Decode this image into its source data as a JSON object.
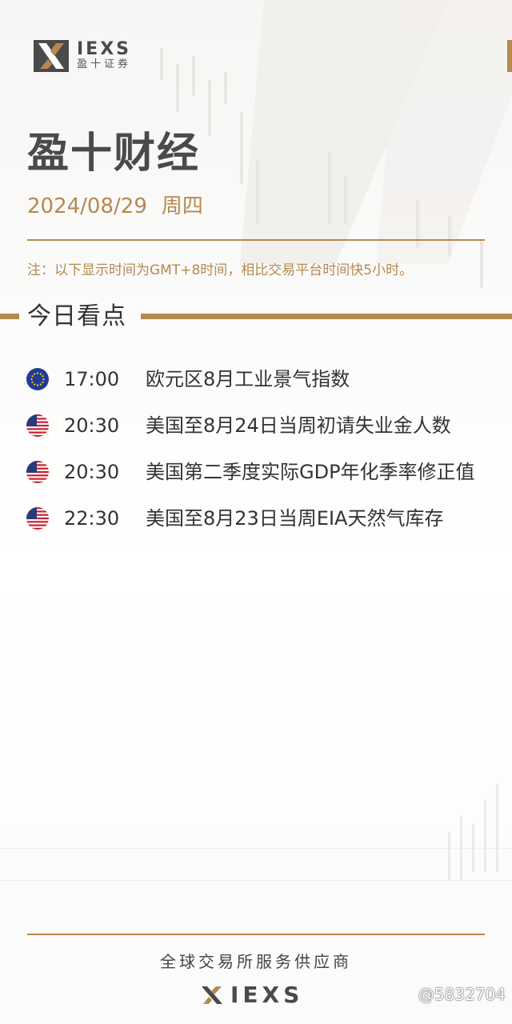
{
  "brand": {
    "wordmark": "IEXS",
    "subtitle": "盈十证券",
    "accent_color": "#b5894f",
    "text_color": "#4a4a4a"
  },
  "header": {
    "title": "盈十财经",
    "date": "2024/08/29",
    "weekday": "周四",
    "note": "注：以下显示时间为GMT+8时间，相比交易平台时间快5小时。"
  },
  "section": {
    "title": "今日看点"
  },
  "events": [
    {
      "flag": "eu-flag-icon",
      "time": "17:00",
      "name": "欧元区8月工业景气指数"
    },
    {
      "flag": "us-flag-icon",
      "time": "20:30",
      "name": "美国至8月24日当周初请失业金人数"
    },
    {
      "flag": "us-flag-icon",
      "time": "20:30",
      "name": "美国第二季度实际GDP年化季率修正值"
    },
    {
      "flag": "us-flag-icon",
      "time": "22:30",
      "name": "美国至8月23日当周EIA天然气库存"
    }
  ],
  "footer": {
    "slogan": "全球交易所服务供应商",
    "wordmark": "IEXS",
    "watermark": "@5832704"
  }
}
